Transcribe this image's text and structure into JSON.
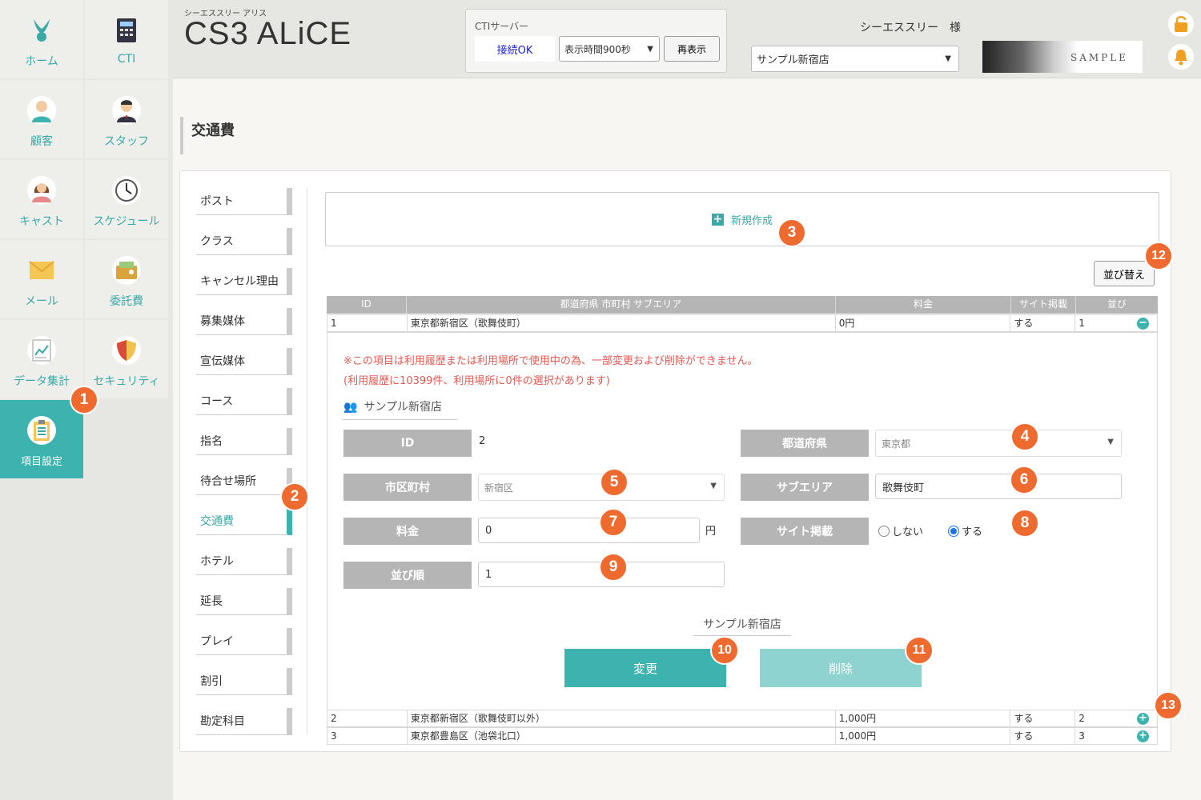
{
  "sidebar": {
    "items": [
      {
        "label": "ホーム",
        "icon": "rabbit-icon"
      },
      {
        "label": "CTI",
        "icon": "phone-icon"
      },
      {
        "label": "顧客",
        "icon": "customer-icon"
      },
      {
        "label": "スタッフ",
        "icon": "staff-icon"
      },
      {
        "label": "キャスト",
        "icon": "cast-icon"
      },
      {
        "label": "スケジュール",
        "icon": "clock-icon"
      },
      {
        "label": "メール",
        "icon": "mail-icon"
      },
      {
        "label": "委託費",
        "icon": "wallet-icon"
      },
      {
        "label": "データ集計",
        "icon": "report-icon"
      },
      {
        "label": "セキュリティ",
        "icon": "shield-icon"
      },
      {
        "label": "項目設定",
        "icon": "clipboard-icon"
      }
    ]
  },
  "header": {
    "subtitle": "シーエススリー アリス",
    "title": "CS3 ALiCE",
    "cti": {
      "label": "CTIサーバー",
      "status": "接続OK",
      "select": "表示時間900秒",
      "refresh": "再表示"
    },
    "user": "シーエススリー　様",
    "store_select": "サンプル新宿店",
    "logo_text": "SAMPLE"
  },
  "page_title": "交通費",
  "subnav": [
    "ポスト",
    "クラス",
    "キャンセル理由",
    "募集媒体",
    "宣伝媒体",
    "コース",
    "指名",
    "待合せ場所",
    "交通費",
    "ホテル",
    "延長",
    "プレイ",
    "割引",
    "勘定科目"
  ],
  "new_button": "新規作成",
  "sort_button": "並び替え",
  "table": {
    "headers": [
      "ID",
      "都道府県 市町村 サブエリア",
      "料金",
      "サイト掲載",
      "並び"
    ],
    "rows": [
      [
        "1",
        "東京都新宿区（歌舞伎町）",
        "0円",
        "する",
        "1"
      ],
      [
        "2",
        "東京都新宿区（歌舞伎町以外）",
        "1,000円",
        "する",
        "2"
      ],
      [
        "3",
        "東京都豊島区（池袋北口）",
        "1,000円",
        "する",
        "3"
      ]
    ]
  },
  "detail": {
    "warning1": "※この項目は利用履歴または利用場所で使用中の為、一部変更および削除ができません。",
    "warning2": "(利用履歴に10399件、利用場所に0件の選択があります)",
    "store": "サンプル新宿店",
    "labels": {
      "id": "ID",
      "pref": "都道府県",
      "city": "市区町村",
      "subarea": "サブエリア",
      "fee": "料金",
      "site": "サイト掲載",
      "order": "並び順"
    },
    "values": {
      "id": "2",
      "pref": "東京都",
      "city": "新宿区",
      "subarea": "歌舞伎町",
      "fee": "0",
      "yen": "円",
      "order": "1"
    },
    "radio": {
      "off": "しない",
      "on": "する"
    },
    "footer_store": "サンプル新宿店",
    "change": "変更",
    "delete": "削除"
  },
  "badges": [
    "1",
    "2",
    "3",
    "4",
    "5",
    "6",
    "7",
    "8",
    "9",
    "10",
    "11",
    "12",
    "13"
  ],
  "colors": {
    "accent": "#3db3b0",
    "badge": "#ef6a2e",
    "warning": "#e8574f"
  }
}
